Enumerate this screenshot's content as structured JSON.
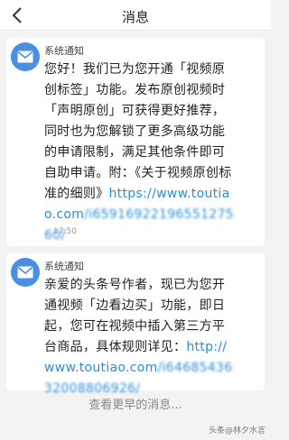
{
  "header": {
    "title": "消息"
  },
  "messages": [
    {
      "sender": "系统通知",
      "text": "您好！我们已为您开通「视频原创标签」功能。发布原创视频时「声明原创」可获得更好推荐，同时也为您解锁了更多高级功能的申请限制，满足其他条件即可自助申请。附：《关于视频原创标准的细则》",
      "link": "https://www.toutiao.com",
      "link_suffix": "/i6591692219655127560/",
      "time": "17:50"
    },
    {
      "sender": "系统通知",
      "text": "亲爱的头条号作者，现已为您开通视频「边看边买」功能，即日起，您可在视频中插入第三方平台商品，具体规则详见：",
      "link": "http://www.toutiao.com",
      "link_suffix": "/i6468543632008806926/",
      "time": ""
    }
  ],
  "footer": {
    "more_label": "查看更早的消息..."
  },
  "watermark": "头条@林夕水言",
  "colors": {
    "accent": "#4a8fe2",
    "link": "#2a8ed8",
    "background": "#f3f3f3"
  }
}
